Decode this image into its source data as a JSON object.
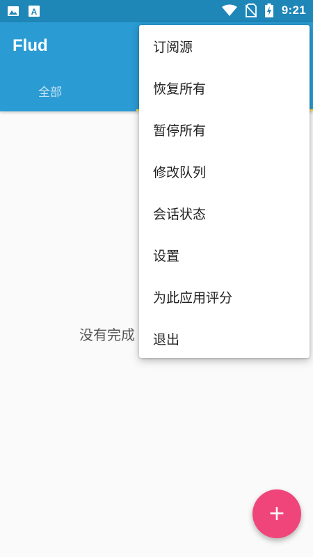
{
  "status_bar": {
    "time": "9:21",
    "left_icons": [
      "image-icon",
      "app-a-icon"
    ],
    "right_icons": [
      "wifi-icon",
      "no-sim-icon",
      "battery-charging-icon"
    ]
  },
  "app_bar": {
    "title": "Flud",
    "tabs": [
      {
        "label": "全部"
      }
    ]
  },
  "empty_state": {
    "text": "没有完成"
  },
  "overflow_menu": {
    "items": [
      {
        "label": "订阅源"
      },
      {
        "label": "恢复所有"
      },
      {
        "label": "暂停所有"
      },
      {
        "label": "修改队列"
      },
      {
        "label": "会话状态"
      },
      {
        "label": "设置"
      },
      {
        "label": "为此应用评分"
      },
      {
        "label": "退出"
      }
    ]
  },
  "fab": {
    "icon": "plus-icon",
    "symbol": "+"
  },
  "colors": {
    "status_bar": "#1f86b8",
    "app_bar": "#2a9bd3",
    "tab_indicator": "#ffd54f",
    "fab": "#f0457a",
    "background": "#fafafa"
  }
}
